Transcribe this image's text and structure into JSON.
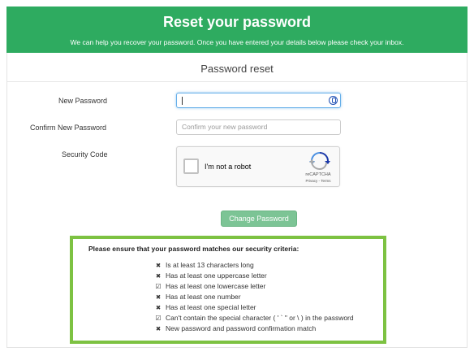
{
  "header": {
    "title": "Reset your password",
    "subtitle": "We can help you recover your password. Once you have entered your details below please check your inbox."
  },
  "form": {
    "card_title": "Password reset",
    "new_password_label": "New Password",
    "new_password_value": "",
    "confirm_password_label": "Confirm New Password",
    "confirm_password_placeholder": "Confirm your new password",
    "security_code_label": "Security Code",
    "submit_label": "Change Password"
  },
  "recaptcha": {
    "label": "I'm not a robot",
    "brand": "reCAPTCHA",
    "terms": "Privacy - Terms"
  },
  "criteria": {
    "heading": "Please ensure that your password matches our security criteria:",
    "items": [
      {
        "text": "Is at least 13 characters long",
        "met": false,
        "icon": "times-icon"
      },
      {
        "text": "Has at least one uppercase letter",
        "met": false,
        "icon": "times-icon"
      },
      {
        "text": "Has at least one lowercase letter",
        "met": true,
        "icon": "check-square-icon"
      },
      {
        "text": "Has at least one number",
        "met": false,
        "icon": "times-icon"
      },
      {
        "text": "Has at least one special letter",
        "met": false,
        "icon": "times-icon"
      },
      {
        "text": "Can't contain the special character ( ' ` \" or \\ ) in the password",
        "met": true,
        "icon": "check-square-icon"
      },
      {
        "text": "New password and password confirmation match",
        "met": false,
        "icon": "times-icon"
      }
    ]
  },
  "colors": {
    "header_bg": "#2eab60",
    "button_bg": "#7cc495",
    "criteria_border": "#7dc242",
    "focus_border": "#66afe9"
  }
}
